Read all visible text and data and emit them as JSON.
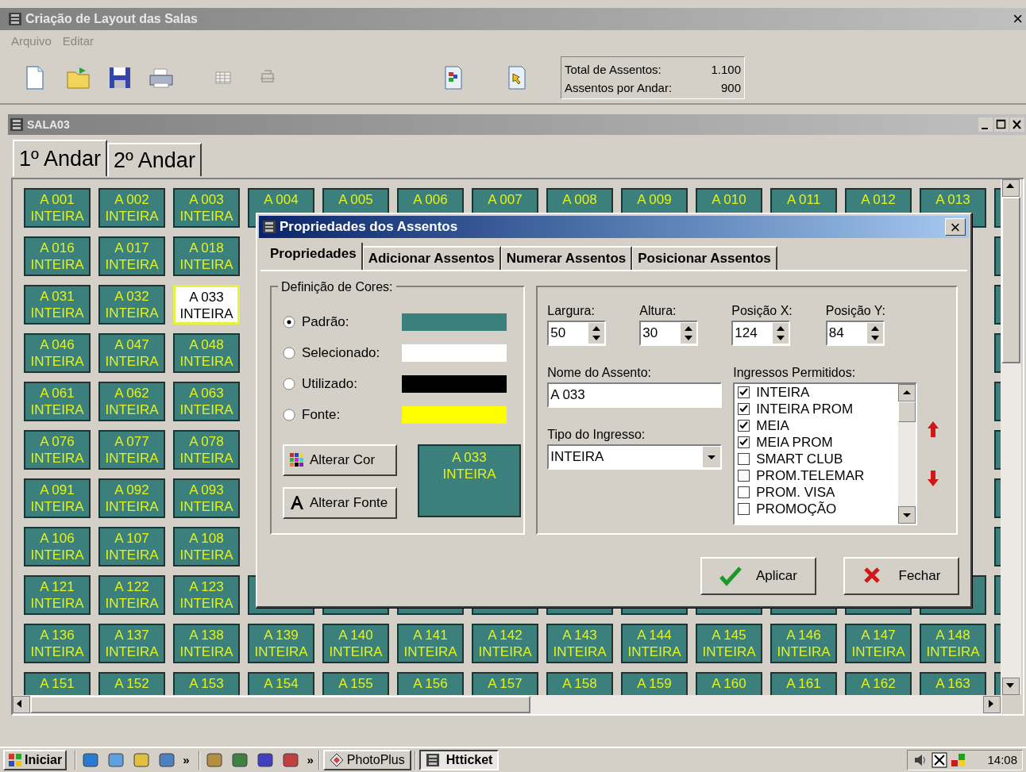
{
  "window": {
    "title": "Criação de Layout das Salas",
    "close": "×"
  },
  "menu": [
    {
      "label": "Arquivo",
      "disabled": true
    },
    {
      "label": "Editar",
      "disabled": true
    }
  ],
  "toolbar": [
    {
      "kind": "new",
      "disabled": false
    },
    {
      "kind": "open",
      "disabled": false
    },
    {
      "kind": "save",
      "disabled": false
    },
    {
      "kind": "print",
      "disabled": false
    },
    {
      "kind": "grid",
      "disabled": true
    },
    {
      "kind": "printer",
      "disabled": true
    },
    {
      "kind": "doc-grid",
      "disabled": false
    },
    {
      "kind": "doc-hand",
      "disabled": false
    }
  ],
  "totals": [
    {
      "label": "Total de Assentos:",
      "value": "1.100"
    },
    {
      "label": "Assentos por Andar:",
      "value": "900"
    }
  ],
  "child_window": {
    "title": "SALA03"
  },
  "floor_tabs": [
    {
      "label": "1º Andar",
      "selected": true
    },
    {
      "label": "2º Andar",
      "selected": false
    }
  ],
  "seat_rows": [
    {
      "seats": [
        {
          "label": "A 001",
          "ticket": "INTEIRA",
          "selected": false
        },
        {
          "label": "A 002",
          "ticket": "INTEIRA",
          "selected": false
        },
        {
          "label": "A 003",
          "ticket": "INTEIRA",
          "selected": false
        },
        {
          "label": "A 004",
          "selected": false
        },
        {
          "label": "A 005",
          "selected": false
        },
        {
          "label": "A 006",
          "selected": false
        },
        {
          "label": "A 007",
          "selected": false
        },
        {
          "label": "A 008",
          "selected": false
        },
        {
          "label": "A 009",
          "selected": false
        },
        {
          "label": "A 010",
          "selected": false
        },
        {
          "label": "A 011",
          "selected": false
        },
        {
          "label": "A 012",
          "selected": false
        },
        {
          "label": "A 013",
          "selected": false
        }
      ]
    },
    {
      "seats": [
        {
          "label": "A 016",
          "ticket": "INTEIRA",
          "selected": false
        },
        {
          "label": "A 017",
          "ticket": "INTEIRA",
          "selected": false
        },
        {
          "label": "A 018",
          "ticket": "INTEIRA",
          "selected": false
        }
      ]
    },
    {
      "seats": [
        {
          "label": "A 031",
          "ticket": "INTEIRA",
          "selected": false
        },
        {
          "label": "A 032",
          "ticket": "INTEIRA",
          "selected": false
        },
        {
          "label": "A 033",
          "ticket": "INTEIRA",
          "selected": true
        }
      ]
    },
    {
      "seats": [
        {
          "label": "A 046",
          "ticket": "INTEIRA",
          "selected": false
        },
        {
          "label": "A 047",
          "ticket": "INTEIRA",
          "selected": false
        },
        {
          "label": "A 048",
          "ticket": "INTEIRA",
          "selected": false
        }
      ]
    },
    {
      "seats": [
        {
          "label": "A 061",
          "ticket": "INTEIRA",
          "selected": false
        },
        {
          "label": "A 062",
          "ticket": "INTEIRA",
          "selected": false
        },
        {
          "label": "A 063",
          "ticket": "INTEIRA",
          "selected": false
        }
      ]
    },
    {
      "seats": [
        {
          "label": "A 076",
          "ticket": "INTEIRA",
          "selected": false
        },
        {
          "label": "A 077",
          "ticket": "INTEIRA",
          "selected": false
        },
        {
          "label": "A 078",
          "ticket": "INTEIRA",
          "selected": false
        }
      ]
    },
    {
      "seats": [
        {
          "label": "A 091",
          "ticket": "INTEIRA",
          "selected": false
        },
        {
          "label": "A 092",
          "ticket": "INTEIRA",
          "selected": false
        },
        {
          "label": "A 093",
          "ticket": "INTEIRA",
          "selected": false
        }
      ]
    },
    {
      "seats": [
        {
          "label": "A 106",
          "ticket": "INTEIRA",
          "selected": false
        },
        {
          "label": "A 107",
          "ticket": "INTEIRA",
          "selected": false
        },
        {
          "label": "A 108",
          "ticket": "INTEIRA",
          "selected": false
        }
      ]
    },
    {
      "seats": [
        {
          "label": "A 121",
          "ticket": "INTEIRA",
          "selected": false
        },
        {
          "label": "A 122",
          "ticket": "INTEIRA",
          "selected": false
        },
        {
          "label": "A 123",
          "ticket": "INTEIRA",
          "selected": false
        }
      ]
    },
    {
      "seats": [
        {
          "label": "A 136",
          "ticket": "INTEIRA",
          "selected": false
        },
        {
          "label": "A 137",
          "ticket": "INTEIRA",
          "selected": false
        },
        {
          "label": "A 138",
          "ticket": "INTEIRA",
          "selected": false
        },
        {
          "label": "A 139",
          "ticket": "INTEIRA",
          "selected": false
        },
        {
          "label": "A 140",
          "ticket": "INTEIRA",
          "selected": false
        },
        {
          "label": "A 141",
          "ticket": "INTEIRA",
          "selected": false
        },
        {
          "label": "A 142",
          "ticket": "INTEIRA",
          "selected": false
        },
        {
          "label": "A 143",
          "ticket": "INTEIRA",
          "selected": false
        },
        {
          "label": "A 144",
          "ticket": "INTEIRA",
          "selected": false
        },
        {
          "label": "A 145",
          "ticket": "INTEIRA",
          "selected": false
        },
        {
          "label": "A 146",
          "ticket": "INTEIRA",
          "selected": false
        },
        {
          "label": "A 147",
          "ticket": "INTEIRA",
          "selected": false
        },
        {
          "label": "A 148",
          "ticket": "INTEIRA",
          "selected": false
        }
      ]
    },
    {
      "seats": [
        {
          "label": "A 151",
          "selected": false
        },
        {
          "label": "A 152",
          "selected": false
        },
        {
          "label": "A 153",
          "selected": false
        },
        {
          "label": "A 154",
          "selected": false
        },
        {
          "label": "A 155",
          "selected": false
        },
        {
          "label": "A 156",
          "selected": false
        },
        {
          "label": "A 157",
          "selected": false
        },
        {
          "label": "A 158",
          "selected": false
        },
        {
          "label": "A 159",
          "selected": false
        },
        {
          "label": "A 160",
          "selected": false
        },
        {
          "label": "A 161",
          "selected": false
        },
        {
          "label": "A 162",
          "selected": false
        },
        {
          "label": "A 163",
          "selected": false
        }
      ]
    }
  ],
  "dialog": {
    "title": "Propriedades dos Assentos",
    "close": "×",
    "tabs": [
      {
        "label": "Propriedades",
        "selected": true
      },
      {
        "label": "Adicionar Assentos",
        "selected": false
      },
      {
        "label": "Numerar Assentos",
        "selected": false
      },
      {
        "label": "Posicionar Assentos",
        "selected": false
      }
    ],
    "colors": {
      "title": "Definição de Cores:",
      "options": [
        {
          "label": "Padrão:",
          "selected": true,
          "color": "#3b807c"
        },
        {
          "label": "Selecionado:",
          "selected": false,
          "color": "#ffffff"
        },
        {
          "label": "Utilizado:",
          "selected": false,
          "color": "#000000"
        },
        {
          "label": "Fonte:",
          "selected": false,
          "color": "#ffff00"
        }
      ]
    },
    "color_buttons": [
      {
        "kind": "palette",
        "label": "Alterar Cor"
      },
      {
        "kind": "font",
        "label": "Alterar Fonte"
      }
    ],
    "preview": {
      "label": "A 033",
      "ticket": "INTEIRA"
    },
    "spinners": [
      {
        "label": "Largura:",
        "value": "50"
      },
      {
        "label": "Altura:",
        "value": "30"
      },
      {
        "label": "Posição X:",
        "value": "124"
      },
      {
        "label": "Posição Y:",
        "value": "84"
      }
    ],
    "seat_name": {
      "label": "Nome do Assento:",
      "value": "A 033"
    },
    "ticket_type": {
      "label": "Tipo do Ingresso:",
      "value": "INTEIRA"
    },
    "allowed_tickets": {
      "label": "Ingressos Permitidos:",
      "items": [
        {
          "label": "INTEIRA",
          "checked": true
        },
        {
          "label": "INTEIRA PROM",
          "checked": true
        },
        {
          "label": "MEIA",
          "checked": true
        },
        {
          "label": "MEIA PROM",
          "checked": true
        },
        {
          "label": "SMART CLUB",
          "checked": false
        },
        {
          "label": "PROM.TELEMAR",
          "checked": false
        },
        {
          "label": "PROM. VISA",
          "checked": false
        },
        {
          "label": "PROMOÇÃO",
          "checked": false
        }
      ]
    },
    "buttons": [
      {
        "kind": "apply",
        "label": "Aplicar"
      },
      {
        "kind": "close",
        "label": "Fechar"
      }
    ]
  },
  "taskbar": {
    "start": "Iniciar",
    "more": [
      "»",
      "»"
    ],
    "windows": [
      {
        "label": "PhotoPlus",
        "selected": false
      },
      {
        "label": "Htticket",
        "selected": true
      }
    ],
    "clock": "14:08"
  }
}
